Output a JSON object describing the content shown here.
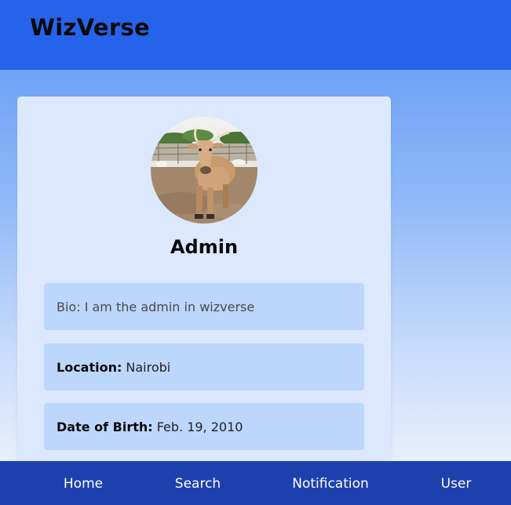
{
  "app": {
    "brand": "WizVerse"
  },
  "profile": {
    "avatar_alt": "profile photo of a cow",
    "username": "Admin",
    "bio": "Bio: I am the admin in wizverse",
    "location_label": "Location:",
    "location_value": "Nairobi",
    "dob_label": "Date of Birth:",
    "dob_value": "Feb. 19, 2010"
  },
  "nav": {
    "items": [
      {
        "label": "Home"
      },
      {
        "label": "Search"
      },
      {
        "label": "Notification"
      },
      {
        "label": "User"
      }
    ]
  },
  "colors": {
    "header_bg": "#2563eb",
    "nav_bg": "#1e40af",
    "card_bg": "#dbe8fe",
    "info_box_bg": "#bcd6fc"
  }
}
